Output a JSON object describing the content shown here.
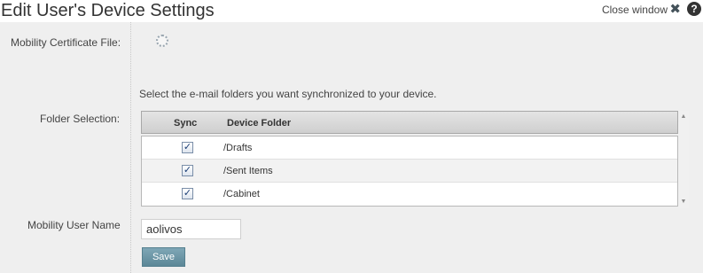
{
  "header": {
    "title": "Edit User's Device Settings",
    "close_label": "Close window",
    "close_glyph": "✖",
    "help_glyph": "?"
  },
  "form": {
    "cert_label": "Mobility Certificate File:",
    "folder_selection_label": "Folder Selection:",
    "instruction": "Select the e-mail folders you want synchronized to your device.",
    "user_name_label": "Mobility User Name",
    "user_name_value": "aolivos",
    "save_label": "Save"
  },
  "folders": {
    "columns": [
      "Sync",
      "Device Folder"
    ],
    "rows": [
      {
        "folder": "/Drafts",
        "sync": true
      },
      {
        "folder": "/Sent Items",
        "sync": true
      },
      {
        "folder": "/Cabinet",
        "sync": true
      }
    ]
  },
  "icons": {
    "check_glyph": "✓",
    "scroll_up_glyph": "▲",
    "scroll_down_glyph": "▼"
  }
}
